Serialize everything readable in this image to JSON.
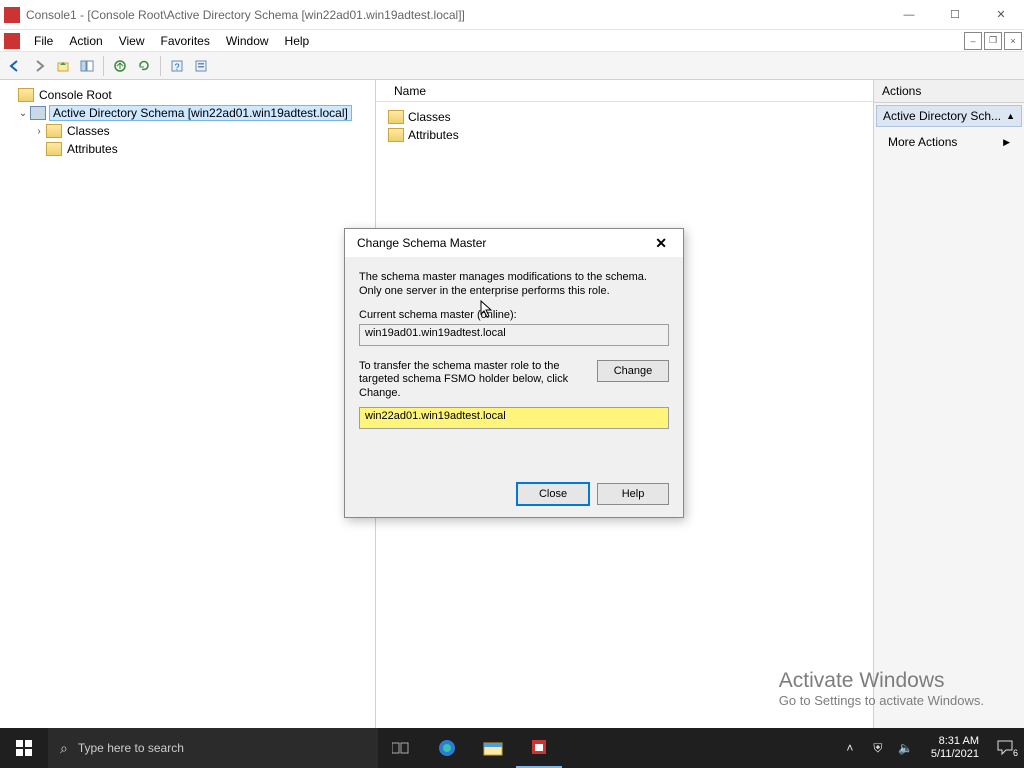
{
  "window": {
    "title": "Console1 - [Console Root\\Active Directory Schema [win22ad01.win19adtest.local]]"
  },
  "menu": {
    "file": "File",
    "action": "Action",
    "view": "View",
    "favorites": "Favorites",
    "window": "Window",
    "help": "Help"
  },
  "tree": {
    "root": "Console Root",
    "adSchema": "Active Directory Schema [win22ad01.win19adtest.local]",
    "classes": "Classes",
    "attributes": "Attributes"
  },
  "list": {
    "header_name": "Name",
    "items": [
      "Classes",
      "Attributes"
    ]
  },
  "actions": {
    "header": "Actions",
    "section": "Active Directory Sch...",
    "more": "More Actions"
  },
  "dialog": {
    "title": "Change Schema Master",
    "desc": "The schema master manages modifications to the schema. Only one server in the enterprise performs this role.",
    "current_label": "Current schema master (online):",
    "current_value": "win19ad01.win19adtest.local",
    "transfer_text": "To transfer the schema master role to the targeted schema FSMO holder below, click Change.",
    "target_value": "win22ad01.win19adtest.local",
    "change": "Change",
    "close": "Close",
    "help": "Help"
  },
  "watermark": {
    "line1": "Activate Windows",
    "line2": "Go to Settings to activate Windows."
  },
  "taskbar": {
    "search_placeholder": "Type here to search",
    "time": "8:31 AM",
    "date": "5/11/2021",
    "notif_count": "6"
  }
}
